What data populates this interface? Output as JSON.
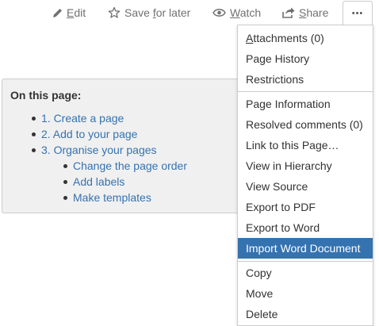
{
  "toolbar": {
    "edit_label": "Edit",
    "save_label": "Save for later",
    "watch_label": "Watch",
    "share_label": "Share",
    "more_label": "•••"
  },
  "toc": {
    "title": "On this page:",
    "items": [
      {
        "label": "1. Create a page"
      },
      {
        "label": "2. Add to your page"
      },
      {
        "label": "3. Organise your pages"
      }
    ],
    "subitems": [
      {
        "label": "Change the page order"
      },
      {
        "label": "Add labels"
      },
      {
        "label": "Make templates"
      }
    ]
  },
  "menu": {
    "group1": [
      {
        "label": "Attachments (0)"
      },
      {
        "label": "Page History"
      },
      {
        "label": "Restrictions"
      }
    ],
    "group2": [
      {
        "label": "Page Information"
      },
      {
        "label": "Resolved comments (0)"
      },
      {
        "label": "Link to this Page…"
      },
      {
        "label": "View in Hierarchy"
      },
      {
        "label": "View Source"
      },
      {
        "label": "Export to PDF"
      },
      {
        "label": "Export to Word"
      },
      {
        "label": "Import Word Document"
      }
    ],
    "group3": [
      {
        "label": "Copy"
      },
      {
        "label": "Move"
      },
      {
        "label": "Delete"
      }
    ],
    "highlighted": "Import Word Document"
  },
  "colors": {
    "link": "#3572b0",
    "highlight_bg": "#3572b0",
    "toolbar_text": "#707070"
  }
}
